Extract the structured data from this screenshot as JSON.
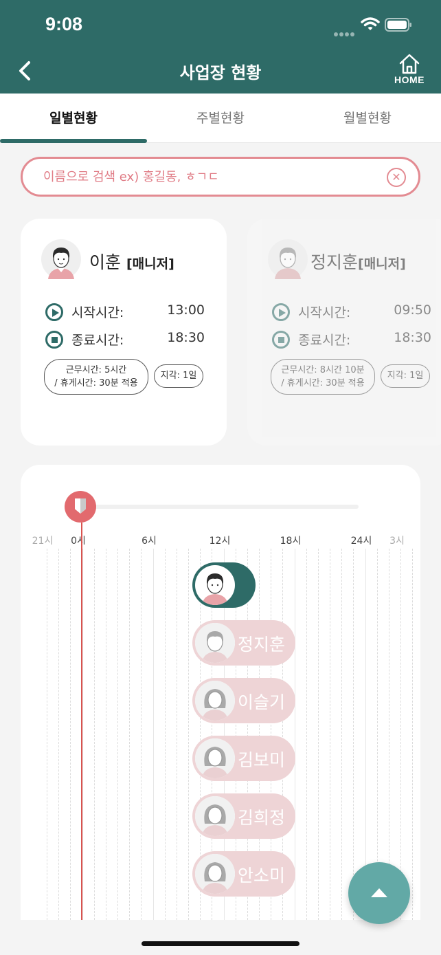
{
  "status_bar": {
    "time": "9:08"
  },
  "header": {
    "title": "사업장 현황",
    "home_label": "HOME"
  },
  "tabs": [
    {
      "label": "일별현황",
      "active": true
    },
    {
      "label": "주별현황",
      "active": false
    },
    {
      "label": "월별현황",
      "active": false
    }
  ],
  "search": {
    "placeholder": "이름으로 검색 ex) 홍길동, ㅎㄱㄷ",
    "value": ""
  },
  "cards": [
    {
      "name": "이훈",
      "role": "[매니저]",
      "start_label": "시작시간:",
      "start_time": "13:00",
      "end_label": "종료시간:",
      "end_time": "18:30",
      "work_line1": "근무시간: 5시간",
      "work_line2": "/ 휴게시간: 30분 적용",
      "late": "지각: 1일"
    },
    {
      "name": "정지훈",
      "role": "[매니저]",
      "start_label": "시작시간:",
      "start_time": "09:50",
      "end_label": "종료시간:",
      "end_time": "18:30",
      "work_line1": "근무시간: 8시간 10분",
      "work_line2": "/ 휴게시간: 30분 적용",
      "late": "지각: 1일"
    }
  ],
  "timeline": {
    "hour_labels": [
      "21시",
      "0시",
      "6시",
      "12시",
      "18시",
      "24시",
      "3시"
    ],
    "employees": [
      {
        "name": "",
        "active": true,
        "avatar": "male-avatar-icon"
      },
      {
        "name": "정지훈",
        "active": false,
        "avatar": "male-avatar-icon"
      },
      {
        "name": "이슬기",
        "active": false,
        "avatar": "female-avatar-icon"
      },
      {
        "name": "김보미",
        "active": false,
        "avatar": "female-avatar-icon"
      },
      {
        "name": "김희정",
        "active": false,
        "avatar": "female-avatar-icon"
      },
      {
        "name": "안소미",
        "active": false,
        "avatar": "female-avatar-icon"
      }
    ]
  },
  "colors": {
    "primary": "#2e6b67",
    "accent": "#e38b92",
    "marker": "#e26a6e",
    "fab": "#62a9a6"
  }
}
